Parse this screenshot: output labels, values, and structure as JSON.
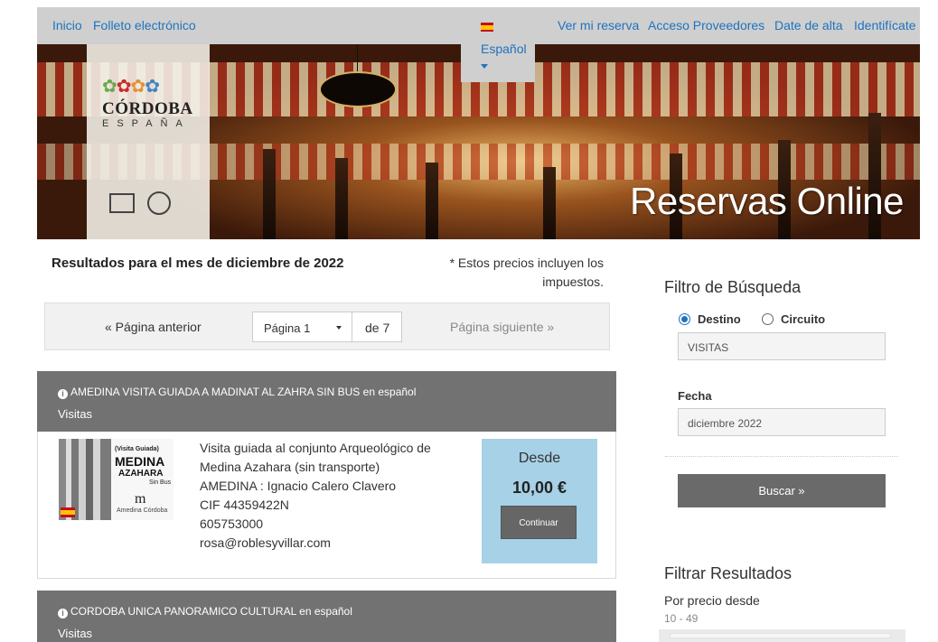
{
  "nav": {
    "left": [
      "Inicio",
      "Folleto electrónico"
    ],
    "right": [
      "Ver mi reserva",
      "Acceso Proveedores",
      "Date de alta",
      "Identifícate"
    ],
    "language": "Español"
  },
  "banner": {
    "logo_name": "CÓRDOBA",
    "logo_country": "ESPAÑA",
    "title": "Reservas Online"
  },
  "results": {
    "title": "Resultados para el mes de diciembre de 2022",
    "tax_note": "* Estos precios incluyen los impuestos."
  },
  "pager": {
    "prev": "« Página anterior",
    "current": "Página 1",
    "of": "de 7",
    "next": "Página siguiente »"
  },
  "items": [
    {
      "title": "AMEDINA VISITA GUIADA A MADINAT AL ZAHRA SIN BUS",
      "lang": "en español",
      "category": "Visitas",
      "thumb": {
        "line1": "(Visita Guiada)",
        "line2": "MEDINA",
        "line3": "AZAHARA",
        "line4": "Sin Bus",
        "line6": "Amedina Córdoba"
      },
      "description": [
        "Visita guiada al conjunto Arqueológico de",
        "Medina Azahara (sin transporte)",
        "AMEDINA : Ignacio Calero Clavero",
        "CIF 44359422N",
        "605753000",
        "rosa@roblesyvillar.com"
      ],
      "from_label": "Desde",
      "price": "10,00 €",
      "button": "Continuar"
    },
    {
      "title": "CORDOBA UNICA PANORAMICO CULTURAL",
      "lang": "en español",
      "category": "Visitas"
    }
  ],
  "sidebar": {
    "filter_title": "Filtro de Búsqueda",
    "radio_destino": "Destino",
    "radio_circuito": "Circuito",
    "destino_value": "VISITAS",
    "fecha_label": "Fecha",
    "fecha_value": "diciembre 2022",
    "search_button": "Buscar »",
    "results_filter_title": "Filtrar Resultados",
    "price_label": "Por precio desde",
    "price_range": "10 - 49"
  },
  "colors": {
    "link": "#1e73be",
    "card_header": "#727272",
    "price_box": "#a6d1e6",
    "button": "#666666"
  }
}
